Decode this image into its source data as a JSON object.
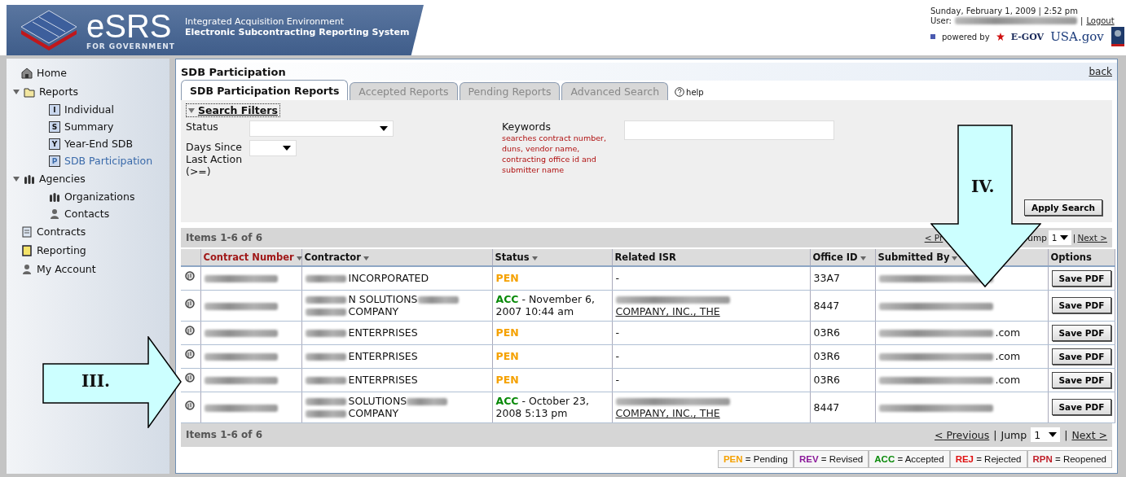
{
  "header": {
    "logo_text": "eSRS",
    "logo_subtitle": "FOR GOVERNMENT",
    "tagline": "Integrated Acquisition Environment",
    "system_name": "Electronic Subcontracting Reporting System",
    "date": "Sunday, February 1, 2009 | 2:52 pm",
    "user_label": "User:",
    "separator": "|",
    "logout": "Logout",
    "powered_by": "powered by",
    "egov": "E-GOV",
    "usagov": "USA.gov"
  },
  "sidebar": {
    "items": [
      {
        "label": "Home",
        "kind": "house",
        "selected": false
      },
      {
        "label": "Reports",
        "kind": "folder",
        "selected": false,
        "expanded": true,
        "children": [
          {
            "label": "Individual",
            "kind": "letter",
            "glyph": "I",
            "selected": false
          },
          {
            "label": "Summary",
            "kind": "letter",
            "glyph": "S",
            "selected": false
          },
          {
            "label": "Year-End SDB",
            "kind": "letter",
            "glyph": "Y",
            "selected": false
          },
          {
            "label": "SDB Participation",
            "kind": "letter",
            "glyph": "P",
            "selected": true
          }
        ]
      },
      {
        "label": "Agencies",
        "kind": "group",
        "selected": false,
        "expanded": true,
        "children": [
          {
            "label": "Organizations",
            "kind": "group",
            "selected": false
          },
          {
            "label": "Contacts",
            "kind": "person",
            "selected": false
          }
        ]
      },
      {
        "label": "Contracts",
        "kind": "document",
        "selected": false
      },
      {
        "label": "Reporting",
        "kind": "notebook",
        "selected": false
      },
      {
        "label": "My Account",
        "kind": "person",
        "selected": false
      }
    ]
  },
  "page": {
    "title": "SDB Participation",
    "back": "back",
    "tabs": [
      {
        "label": "SDB Participation Reports",
        "selected": true
      },
      {
        "label": "Accepted Reports",
        "selected": false
      },
      {
        "label": "Pending Reports",
        "selected": false
      },
      {
        "label": "Advanced Search",
        "selected": false
      }
    ],
    "help": "help",
    "filters": {
      "title": "Search Filters",
      "expanded": true,
      "status_label": "Status",
      "days_label": "Days Since Last Action (>=)",
      "keywords_label": "Keywords",
      "keywords_hint": "searches contract number, duns, vendor name, contracting office id and submitter name",
      "apply": "Apply Search"
    },
    "items_count": "Items 1-6 of 6",
    "top_pager": {
      "previous": "< Pr",
      "jump": "ump",
      "page": "1",
      "separator": "|",
      "next": "Next >"
    },
    "table": {
      "columns": [
        {
          "sortable": false
        },
        {
          "label": "Contract Number",
          "sortable": true,
          "sorted": true
        },
        {
          "label": "Contractor",
          "sortable": true,
          "sorted": false
        },
        {
          "label": "Status",
          "sortable": true,
          "sorted": false
        },
        {
          "label": "Related ISR",
          "sortable": false,
          "sorted": false
        },
        {
          "label": "Office ID",
          "sortable": true,
          "sorted": false
        },
        {
          "label": "Submitted By",
          "sortable": true,
          "sorted": false
        },
        {
          "label": "Options",
          "sortable": false,
          "sorted": false
        }
      ],
      "rows": [
        {
          "contract_number": [
            {
              "kind": "redacted"
            }
          ],
          "contractor": [
            {
              "kind": "redacted"
            },
            {
              "kind": "text",
              "text": "INCORPORATED"
            }
          ],
          "status": {
            "code": "PEN",
            "color": "#f5a100"
          },
          "related_isr": [
            {
              "kind": "text",
              "text": "-"
            }
          ],
          "office_id": "33A7",
          "submitted_by": [
            {
              "kind": "redacted"
            }
          ],
          "action": "Save PDF"
        },
        {
          "contract_number": [
            {
              "kind": "redacted"
            }
          ],
          "contractor": [
            {
              "kind": "redacted"
            },
            {
              "kind": "text",
              "text": "N SOLUTIONS"
            },
            {
              "kind": "redacted"
            },
            {
              "kind": "break"
            },
            {
              "kind": "redacted"
            },
            {
              "kind": "text",
              "text": "COMPANY"
            }
          ],
          "status": {
            "code": "ACC",
            "color": "#0a8a0a",
            "detail": "- November 6, 2007 10:44 am"
          },
          "related_isr": [
            {
              "kind": "redacted"
            },
            {
              "kind": "break"
            },
            {
              "kind": "link",
              "text": "COMPANY, INC., THE"
            }
          ],
          "office_id": "8447",
          "submitted_by": [
            {
              "kind": "redacted"
            }
          ],
          "action": "Save PDF"
        },
        {
          "contract_number": [
            {
              "kind": "redacted"
            }
          ],
          "contractor": [
            {
              "kind": "redacted"
            },
            {
              "kind": "text",
              "text": "ENTERPRISES"
            }
          ],
          "status": {
            "code": "PEN",
            "color": "#f5a100"
          },
          "related_isr": [
            {
              "kind": "text",
              "text": "-"
            }
          ],
          "office_id": "03R6",
          "submitted_by": [
            {
              "kind": "redacted"
            },
            {
              "kind": "text",
              "text": ".com"
            }
          ],
          "action": "Save PDF"
        },
        {
          "contract_number": [
            {
              "kind": "redacted"
            }
          ],
          "contractor": [
            {
              "kind": "redacted"
            },
            {
              "kind": "text",
              "text": "ENTERPRISES"
            }
          ],
          "status": {
            "code": "PEN",
            "color": "#f5a100"
          },
          "related_isr": [
            {
              "kind": "text",
              "text": "-"
            }
          ],
          "office_id": "03R6",
          "submitted_by": [
            {
              "kind": "redacted"
            },
            {
              "kind": "text",
              "text": ".com"
            }
          ],
          "action": "Save PDF"
        },
        {
          "contract_number": [
            {
              "kind": "redacted"
            }
          ],
          "contractor": [
            {
              "kind": "redacted"
            },
            {
              "kind": "text",
              "text": "ENTERPRISES"
            }
          ],
          "status": {
            "code": "PEN",
            "color": "#f5a100"
          },
          "related_isr": [
            {
              "kind": "text",
              "text": "-"
            }
          ],
          "office_id": "03R6",
          "submitted_by": [
            {
              "kind": "redacted"
            },
            {
              "kind": "text",
              "text": ".com"
            }
          ],
          "action": "Save PDF"
        },
        {
          "contract_number": [
            {
              "kind": "redacted"
            }
          ],
          "contractor": [
            {
              "kind": "redacted"
            },
            {
              "kind": "text",
              "text": "SOLUTIONS"
            },
            {
              "kind": "redacted"
            },
            {
              "kind": "break"
            },
            {
              "kind": "redacted"
            },
            {
              "kind": "text",
              "text": "COMPANY"
            }
          ],
          "status": {
            "code": "ACC",
            "color": "#0a8a0a",
            "detail": "- October 23, 2008 5:13 pm"
          },
          "related_isr": [
            {
              "kind": "redacted"
            },
            {
              "kind": "break"
            },
            {
              "kind": "link",
              "text": "COMPANY, INC., THE"
            }
          ],
          "office_id": "8447",
          "submitted_by": [
            {
              "kind": "redacted"
            }
          ],
          "action": "Save PDF"
        }
      ]
    },
    "bottom_pager": {
      "items_count": "Items 1-6 of 6",
      "previous": "< Previous",
      "separator_left": "|",
      "jump": "Jump",
      "page": "1",
      "separator": "|",
      "next": "Next >"
    },
    "legend": [
      {
        "code": "PEN",
        "text": "= Pending",
        "color": "#f5a100"
      },
      {
        "code": "REV",
        "text": "= Revised",
        "color": "#8b1a9a"
      },
      {
        "code": "ACC",
        "text": "= Accepted",
        "color": "#0a8a0a"
      },
      {
        "code": "REJ",
        "text": "= Rejected",
        "color": "#e01010"
      },
      {
        "code": "RPN",
        "text": "= Reopened",
        "color": "#c0202a"
      }
    ]
  },
  "callouts": [
    {
      "label": "III.",
      "kind": "right-arrow"
    },
    {
      "label": "IV.",
      "kind": "down-arrow"
    }
  ]
}
